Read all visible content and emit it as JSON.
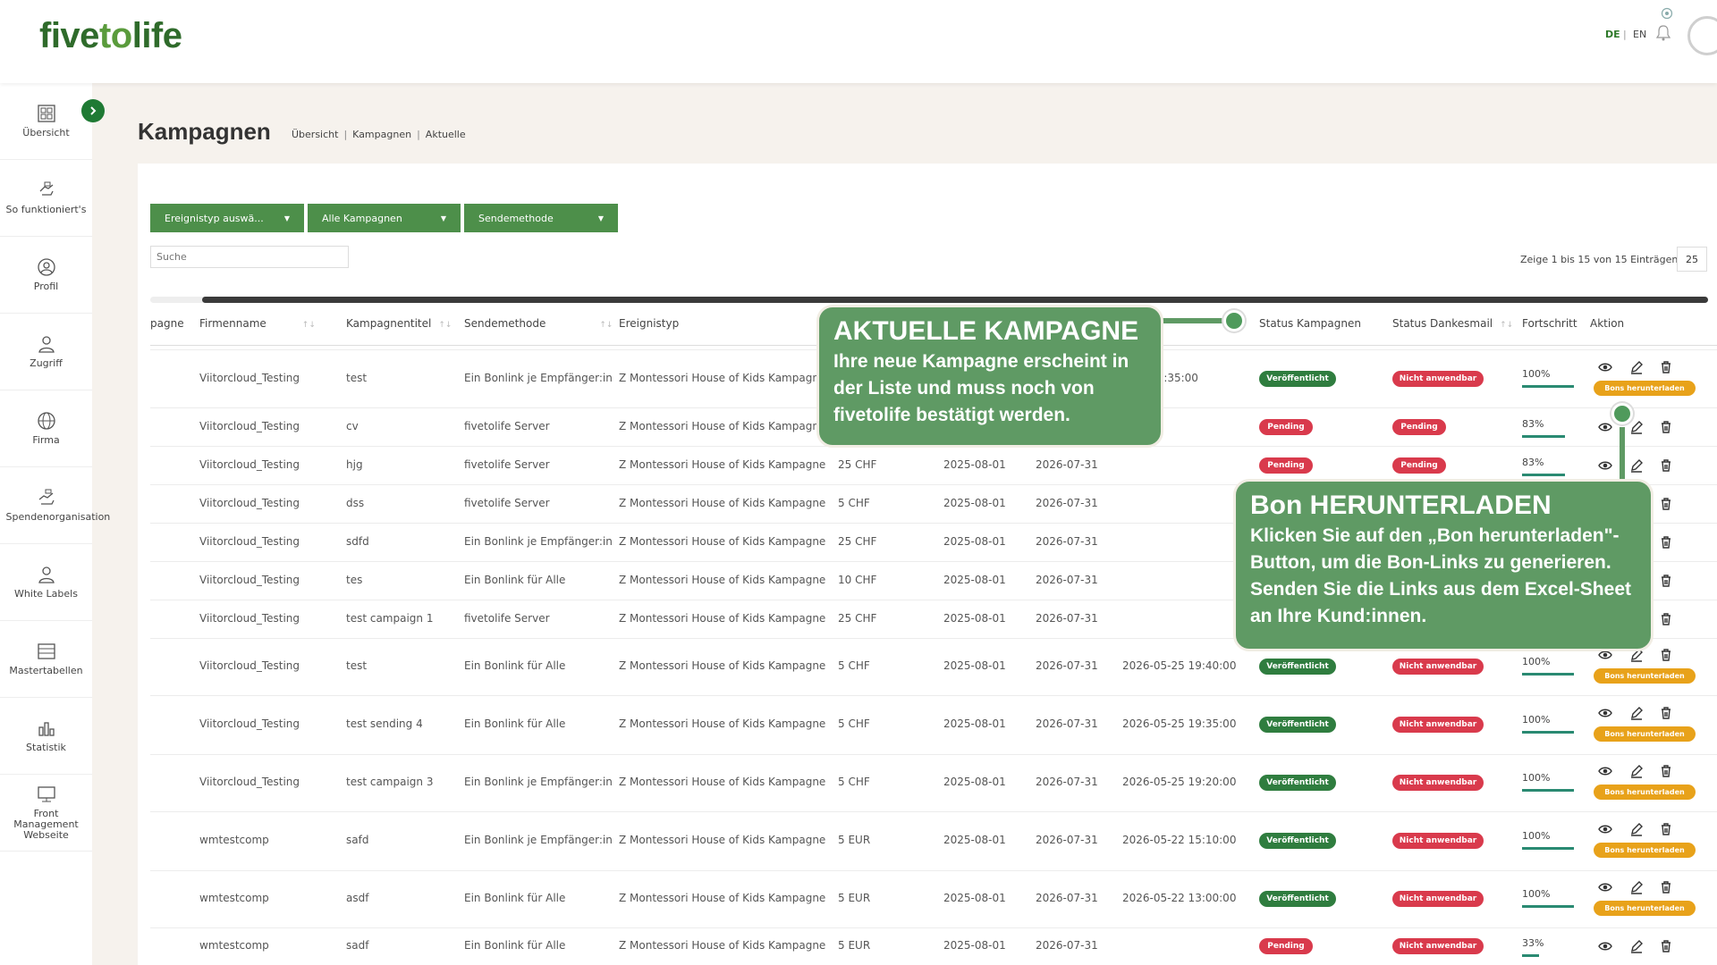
{
  "brand": {
    "logo_left": "five",
    "logo_mid": "to",
    "logo_right": "life"
  },
  "header": {
    "lang_de": "DE",
    "lang_sep": "|",
    "lang_en": "EN"
  },
  "sidebar": {
    "items": [
      {
        "label": "Übersicht",
        "icon": "grid-icon"
      },
      {
        "label": "So funktioniert's",
        "icon": "hand-icon"
      },
      {
        "label": "Profil",
        "icon": "user-circle-icon"
      },
      {
        "label": "Zugriff",
        "icon": "user-key-icon"
      },
      {
        "label": "Firma",
        "icon": "globe-icon"
      },
      {
        "label": "Spendenorganisation",
        "icon": "donation-icon"
      },
      {
        "label": "White Labels",
        "icon": "user-tag-icon"
      },
      {
        "label": "Mastertabellen",
        "icon": "table-icon"
      },
      {
        "label": "Statistik",
        "icon": "bar-chart-icon"
      },
      {
        "label": "Front Management Webseite",
        "icon": "monitor-icon"
      }
    ]
  },
  "page": {
    "title": "Kampagnen",
    "breadcrumb": [
      "Übersicht",
      "Kampagnen",
      "Aktuelle"
    ]
  },
  "filters": {
    "event_type": "Ereignistyp auswä...",
    "campaigns": "Alle Kampagnen",
    "send_method": "Sendemethode"
  },
  "search": {
    "placeholder": "Suche"
  },
  "entries_info": "Zeige 1 bis 15 von 15 Einträgen",
  "page_size": "25",
  "table": {
    "headers": {
      "kampagne": "pagne",
      "firmenname": "Firmenname",
      "titel": "Kampagnentitel",
      "sendemethode": "Sendemethode",
      "ereignistyp": "Ereignistyp",
      "status_kampagnen": "Status Kampagnen",
      "status_dankesmail": "Status Dankesmail",
      "fortschritt": "Fortschritt",
      "aktion": "Aktion"
    },
    "bons_label": "Bons herunterladen",
    "rows": [
      {
        "firma": "Viitorcloud_Testing",
        "titel": "test",
        "methode": "Ein Bonlink je Empfänger:in",
        "ereignis": "Z Montessori House of Kids Kampagne",
        "wert": "",
        "start": "",
        "ende": "",
        "datum": "5-29 12:35:00",
        "status": "Veröffentlicht",
        "dank": "Nicht anwendbar",
        "progress": "100%",
        "pct": 100,
        "bons": true
      },
      {
        "firma": "Viitorcloud_Testing",
        "titel": "cv",
        "methode": "fivetolife Server",
        "ereignis": "Z Montessori House of Kids Kampagne",
        "wert": "",
        "start": "",
        "ende": "",
        "datum": "",
        "status": "Pending",
        "dank": "Pending",
        "progress": "83%",
        "pct": 83,
        "bons": false
      },
      {
        "firma": "Viitorcloud_Testing",
        "titel": "hjg",
        "methode": "fivetolife Server",
        "ereignis": "Z Montessori House of Kids Kampagne",
        "wert": "25 CHF",
        "start": "2025-08-01",
        "ende": "2026-07-31",
        "datum": "",
        "status": "Pending",
        "dank": "Pending",
        "progress": "83%",
        "pct": 83,
        "bons": false
      },
      {
        "firma": "Viitorcloud_Testing",
        "titel": "dss",
        "methode": "fivetolife Server",
        "ereignis": "Z Montessori House of Kids Kampagne",
        "wert": "5 CHF",
        "start": "2025-08-01",
        "ende": "2026-07-31",
        "datum": "",
        "status": "",
        "dank": "",
        "progress": "",
        "pct": 0,
        "bons": false
      },
      {
        "firma": "Viitorcloud_Testing",
        "titel": "sdfd",
        "methode": "Ein Bonlink je Empfänger:in",
        "ereignis": "Z Montessori House of Kids Kampagne",
        "wert": "25 CHF",
        "start": "2025-08-01",
        "ende": "2026-07-31",
        "datum": "",
        "status": "",
        "dank": "",
        "progress": "",
        "pct": 0,
        "bons": false
      },
      {
        "firma": "Viitorcloud_Testing",
        "titel": "tes",
        "methode": "Ein Bonlink für Alle",
        "ereignis": "Z Montessori House of Kids Kampagne",
        "wert": "10 CHF",
        "start": "2025-08-01",
        "ende": "2026-07-31",
        "datum": "",
        "status": "",
        "dank": "",
        "progress": "",
        "pct": 0,
        "bons": false
      },
      {
        "firma": "Viitorcloud_Testing",
        "titel": "test campaign 1",
        "methode": "fivetolife Server",
        "ereignis": "Z Montessori House of Kids Kampagne",
        "wert": "25 CHF",
        "start": "2025-08-01",
        "ende": "2026-07-31",
        "datum": "",
        "status": "",
        "dank": "",
        "progress": "",
        "pct": 0,
        "bons": false
      },
      {
        "firma": "Viitorcloud_Testing",
        "titel": "test",
        "methode": "Ein Bonlink für Alle",
        "ereignis": "Z Montessori House of Kids Kampagne",
        "wert": "5 CHF",
        "start": "2025-08-01",
        "ende": "2026-07-31",
        "datum": "2026-05-25 19:40:00",
        "status": "Veröffentlicht",
        "dank": "Nicht anwendbar",
        "progress": "100%",
        "pct": 100,
        "bons": true
      },
      {
        "firma": "Viitorcloud_Testing",
        "titel": "test sending 4",
        "methode": "Ein Bonlink für Alle",
        "ereignis": "Z Montessori House of Kids Kampagne",
        "wert": "5 CHF",
        "start": "2025-08-01",
        "ende": "2026-07-31",
        "datum": "2026-05-25 19:35:00",
        "status": "Veröffentlicht",
        "dank": "Nicht anwendbar",
        "progress": "100%",
        "pct": 100,
        "bons": true
      },
      {
        "firma": "Viitorcloud_Testing",
        "titel": "test campaign 3",
        "methode": "Ein Bonlink je Empfänger:in",
        "ereignis": "Z Montessori House of Kids Kampagne",
        "wert": "5 CHF",
        "start": "2025-08-01",
        "ende": "2026-07-31",
        "datum": "2026-05-25 19:20:00",
        "status": "Veröffentlicht",
        "dank": "Nicht anwendbar",
        "progress": "100%",
        "pct": 100,
        "bons": true
      },
      {
        "firma": "wmtestcomp",
        "titel": "safd",
        "methode": "Ein Bonlink je Empfänger:in",
        "ereignis": "Z Montessori House of Kids Kampagne",
        "wert": "5 EUR",
        "start": "2025-08-01",
        "ende": "2026-07-31",
        "datum": "2026-05-22 15:10:00",
        "status": "Veröffentlicht",
        "dank": "Nicht anwendbar",
        "progress": "100%",
        "pct": 100,
        "bons": true
      },
      {
        "firma": "wmtestcomp",
        "titel": "asdf",
        "methode": "Ein Bonlink für Alle",
        "ereignis": "Z Montessori House of Kids Kampagne",
        "wert": "5 EUR",
        "start": "2025-08-01",
        "ende": "2026-07-31",
        "datum": "2026-05-22 13:00:00",
        "status": "Veröffentlicht",
        "dank": "Nicht anwendbar",
        "progress": "100%",
        "pct": 100,
        "bons": true
      },
      {
        "firma": "wmtestcomp",
        "titel": "sadf",
        "methode": "Ein Bonlink für Alle",
        "ereignis": "Z Montessori House of Kids Kampagne",
        "wert": "5 EUR",
        "start": "2025-08-01",
        "ende": "2026-07-31",
        "datum": "",
        "status": "Pending",
        "dank": "Nicht anwendbar",
        "progress": "33%",
        "pct": 33,
        "bons": false
      }
    ]
  },
  "callouts": {
    "aktuelle": {
      "title": "AKTUELLE KAMPAGNE",
      "body": "Ihre neue Kampagne erscheint in der Liste und muss noch von fivetolife bestätigt werden."
    },
    "bon": {
      "title": "Bon HERUNTERLADEN",
      "body": "Klicken Sie auf den „Bon herunterladen\"-Button, um die Bon-Links zu generieren. Senden Sie die Links aus dem Excel-Sheet an Ihre Kund:innen."
    }
  },
  "colors": {
    "primary_green": "#4d8f4a",
    "published": "#2f7d3f",
    "not_applicable": "#d93a4c",
    "bons_button": "#e8a21a",
    "callout": "#5f9a64"
  }
}
